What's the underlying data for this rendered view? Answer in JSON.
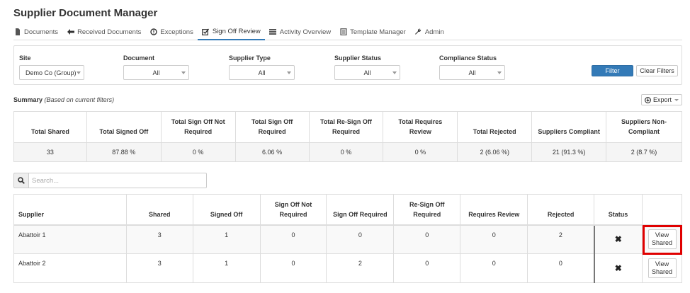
{
  "app": {
    "title": "Supplier Document Manager"
  },
  "nav": {
    "tabs": [
      {
        "label": "Documents",
        "icon": "document-icon"
      },
      {
        "label": "Received Documents",
        "icon": "arrow-left-icon"
      },
      {
        "label": "Exceptions",
        "icon": "exclamation-circle-icon"
      },
      {
        "label": "Sign Off Review",
        "icon": "check-square-icon",
        "active": true
      },
      {
        "label": "Activity Overview",
        "icon": "list-icon"
      },
      {
        "label": "Template Manager",
        "icon": "template-icon"
      },
      {
        "label": "Admin",
        "icon": "wrench-icon"
      }
    ]
  },
  "filters": {
    "site": {
      "label": "Site",
      "value": "Demo Co (Group)"
    },
    "document": {
      "label": "Document",
      "value": "All"
    },
    "supplier_type": {
      "label": "Supplier Type",
      "value": "All"
    },
    "supplier_status": {
      "label": "Supplier Status",
      "value": "All"
    },
    "compliance_status": {
      "label": "Compliance Status",
      "value": "All"
    },
    "filter_button": "Filter",
    "clear_button": "Clear Filters"
  },
  "summary": {
    "heading": "Summary",
    "subheading": "(Based on current filters)",
    "export_label": "Export",
    "headers": [
      "Total Shared",
      "Total Signed Off",
      "Total Sign Off Not Required",
      "Total Sign Off Required",
      "Total Re-Sign Off Required",
      "Total Requires Review",
      "Total Rejected",
      "Suppliers Compliant",
      "Suppliers Non-Compliant"
    ],
    "values": [
      "33",
      "87.88 %",
      "0 %",
      "6.06 %",
      "0 %",
      "0 %",
      "2 (6.06 %)",
      "21 (91.3 %)",
      "2 (8.7 %)"
    ]
  },
  "search": {
    "placeholder": "Search..."
  },
  "suppliers": {
    "headers": [
      "Supplier",
      "Shared",
      "Signed Off",
      "Sign Off Not Required",
      "Sign Off Required",
      "Re-Sign Off Required",
      "Requires Review",
      "Rejected",
      "Status",
      ""
    ],
    "rows": [
      {
        "supplier": "Abattoir 1",
        "shared": "3",
        "signed_off": "1",
        "not_required": "0",
        "required": "0",
        "re_sign": "0",
        "review": "0",
        "rejected": "2",
        "action": "View Shared"
      },
      {
        "supplier": "Abattoir 2",
        "shared": "3",
        "signed_off": "1",
        "not_required": "0",
        "required": "2",
        "re_sign": "0",
        "review": "0",
        "rejected": "0",
        "action": "View Shared"
      }
    ],
    "status_icon": "x-icon"
  },
  "colors": {
    "primary": "#337ab7",
    "highlight": "#e00000"
  }
}
